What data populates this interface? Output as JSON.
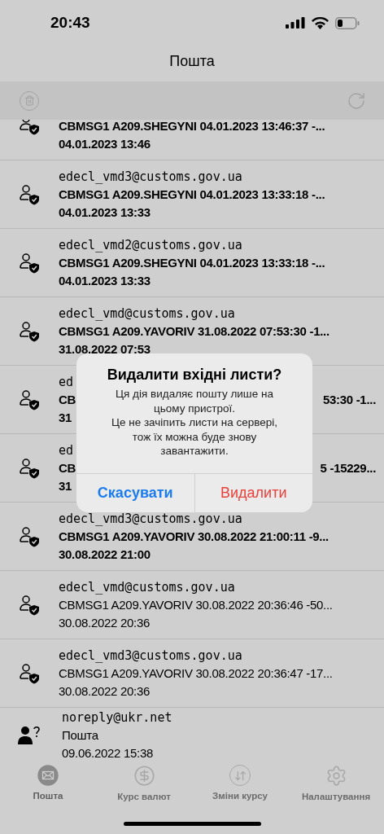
{
  "status_bar": {
    "time": "20:43"
  },
  "title": "Пошта",
  "messages": [
    {
      "kind": "top-cut",
      "unread": true,
      "subject": "CBMSG1 A209.SHEGYNI 04.01.2023 13:46:37 -...",
      "date": "04.01.2023 13:46"
    },
    {
      "kind": "verified",
      "unread": true,
      "sender": "edecl_vmd3@customs.gov.ua",
      "subject": "CBMSG1 A209.SHEGYNI 04.01.2023 13:33:18 -...",
      "date": "04.01.2023 13:33"
    },
    {
      "kind": "verified",
      "unread": true,
      "sender": "edecl_vmd2@customs.gov.ua",
      "subject": "CBMSG1 A209.SHEGYNI 04.01.2023 13:33:18 -...",
      "date": "04.01.2023 13:33"
    },
    {
      "kind": "verified",
      "unread": true,
      "sender": "edecl_vmd@customs.gov.ua",
      "subject": "CBMSG1 A209.YAVORIV 31.08.2022 07:53:30 -1...",
      "date": "31.08.2022 07:53"
    },
    {
      "kind": "covered",
      "unread": true,
      "sender": "ed",
      "subject": "CB",
      "subject_end": "53:30 -1...",
      "date": "31"
    },
    {
      "kind": "covered",
      "unread": true,
      "sender": "ed",
      "subject": "CB",
      "subject_end": "5 -15229...",
      "date": "31"
    },
    {
      "kind": "verified",
      "unread": true,
      "sender": "edecl_vmd3@customs.gov.ua",
      "subject": "CBMSG1 A209.YAVORIV 30.08.2022 21:00:11 -9...",
      "date": "30.08.2022 21:00"
    },
    {
      "kind": "verified",
      "unread": false,
      "sender": "edecl_vmd@customs.gov.ua",
      "subject": "CBMSG1 A209.YAVORIV 30.08.2022 20:36:46 -50...",
      "date": "30.08.2022 20:36"
    },
    {
      "kind": "verified",
      "unread": false,
      "sender": "edecl_vmd3@customs.gov.ua",
      "subject": "CBMSG1 A209.YAVORIV 30.08.2022 20:36:47 -17...",
      "date": "30.08.2022 20:36"
    },
    {
      "kind": "unknown",
      "unread": false,
      "sender": "noreply@ukr.net",
      "subject": "Пошта",
      "date": "09.06.2022 15:38"
    }
  ],
  "dialog": {
    "title": "Видалити вхідні листи?",
    "message": "Ця дія видаляє пошту лише на цьому пристрої.\nЦе не зачіпить листи на сервері, тож їх можна буде знову завантажити.",
    "buttons": [
      {
        "label": "Скасувати",
        "kind": "cancel"
      },
      {
        "label": "Видалити",
        "kind": "destructive"
      }
    ]
  },
  "tabs": [
    {
      "label": "Пошта",
      "kind": "mail",
      "selected": true
    },
    {
      "label": "Курс валют",
      "kind": "currency",
      "selected": false
    },
    {
      "label": "Зміни курсу",
      "kind": "changes",
      "selected": false
    },
    {
      "label": "Налаштування",
      "kind": "settings",
      "selected": false
    }
  ]
}
